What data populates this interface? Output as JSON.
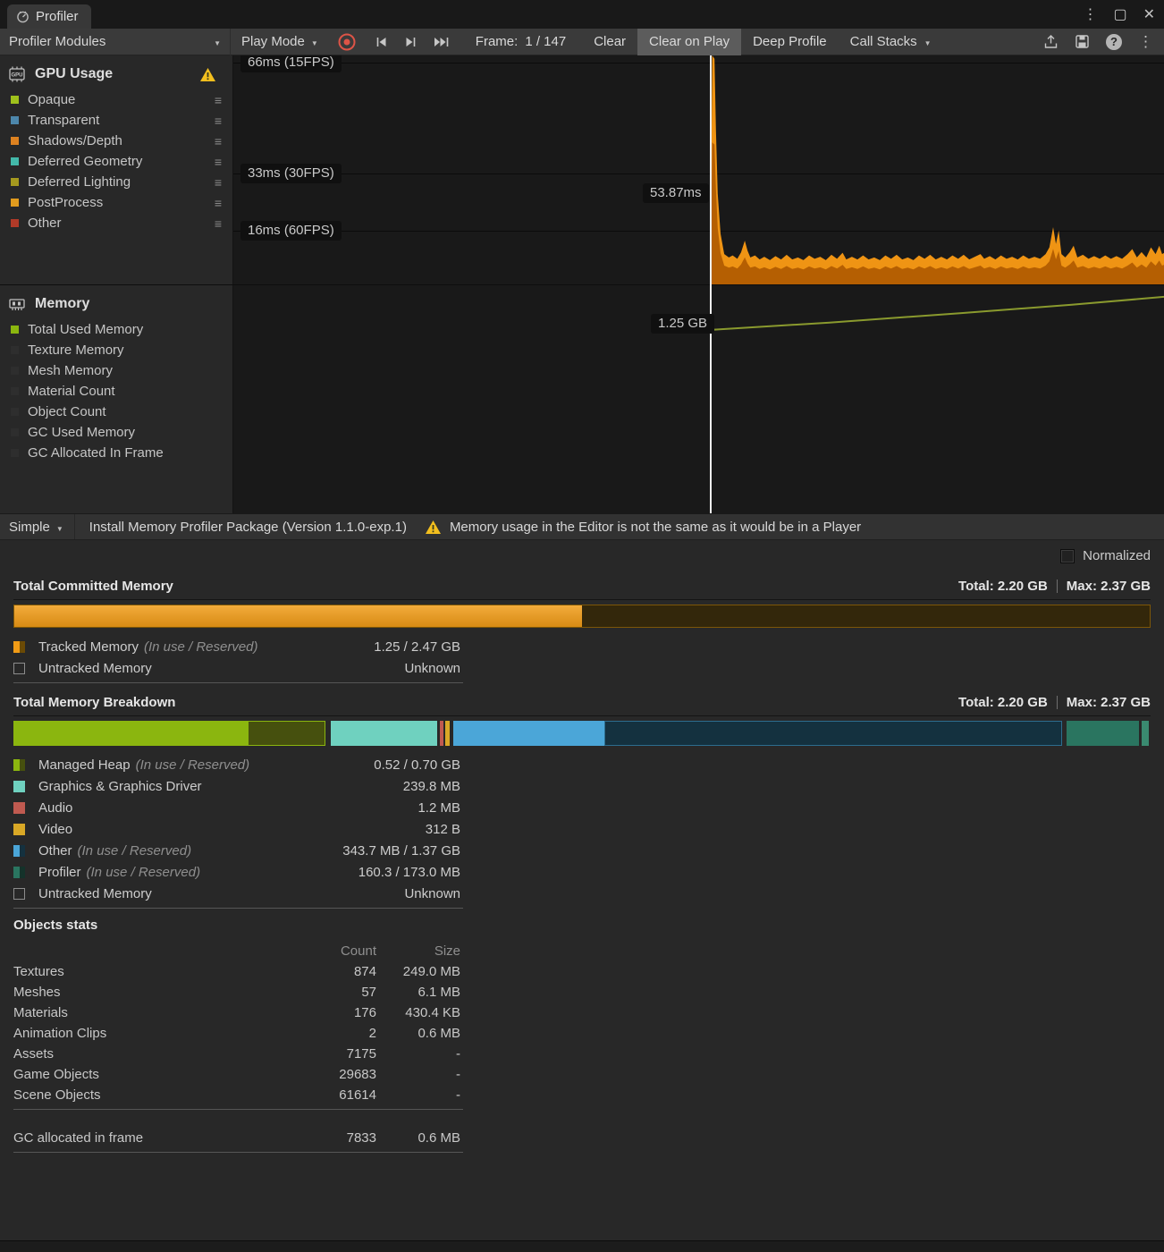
{
  "window": {
    "tab_title": "Profiler",
    "controls": {
      "menu": "⋮",
      "maximize": "▢",
      "close": "✕"
    }
  },
  "toolbar": {
    "modules_dropdown": "Profiler Modules",
    "play_mode_dropdown": "Play Mode",
    "frame_label": "Frame:",
    "frame_value": "1 / 147",
    "clear_button": "Clear",
    "clear_on_play_button": "Clear on Play",
    "deep_profile_button": "Deep Profile",
    "call_stacks_button": "Call Stacks",
    "help_glyph": "?"
  },
  "gpu_module": {
    "title": "GPU Usage",
    "icon_text": "GPU",
    "series": [
      {
        "label": "Opaque",
        "color": "#9fc11c"
      },
      {
        "label": "Transparent",
        "color": "#4d87ab"
      },
      {
        "label": "Shadows/Depth",
        "color": "#dd8220"
      },
      {
        "label": "Deferred Geometry",
        "color": "#43b8a9"
      },
      {
        "label": "Deferred Lighting",
        "color": "#a5991f"
      },
      {
        "label": "PostProcess",
        "color": "#e09b1e"
      },
      {
        "label": "Other",
        "color": "#b03a28"
      }
    ]
  },
  "memory_module": {
    "title": "Memory",
    "series": [
      {
        "label": "Total Used Memory",
        "color": "#8bb60f"
      },
      {
        "label": "Texture Memory",
        "color": "#2e2e2e"
      },
      {
        "label": "Mesh Memory",
        "color": "#2e2e2e"
      },
      {
        "label": "Material Count",
        "color": "#2e2e2e"
      },
      {
        "label": "Object Count",
        "color": "#2e2e2e"
      },
      {
        "label": "GC Used Memory",
        "color": "#2e2e2e"
      },
      {
        "label": "GC Allocated In Frame",
        "color": "#2e2e2e"
      }
    ]
  },
  "chart_data": [
    {
      "type": "area",
      "title": "GPU Usage frame time",
      "ymax_ms": 68,
      "playhead_frac": 0.5125,
      "tooltip": "53.87ms",
      "ylabels": [
        {
          "text": "66ms (15FPS)",
          "ms": 66
        },
        {
          "text": "33ms (30FPS)",
          "ms": 33
        },
        {
          "text": "16ms (60FPS)",
          "ms": 16
        }
      ],
      "colors": {
        "top": "#ef9414",
        "body": "#b55f02"
      },
      "points": [
        [
          0.5125,
          0
        ],
        [
          0.5128,
          22
        ],
        [
          0.514,
          68
        ],
        [
          0.5165,
          67
        ],
        [
          0.518,
          46
        ],
        [
          0.52,
          27
        ],
        [
          0.523,
          15
        ],
        [
          0.527,
          9
        ],
        [
          0.532,
          8
        ],
        [
          0.536,
          8.6
        ],
        [
          0.541,
          7.6
        ],
        [
          0.545,
          9.5
        ],
        [
          0.549,
          13
        ],
        [
          0.552,
          10
        ],
        [
          0.555,
          8
        ],
        [
          0.56,
          8.6
        ],
        [
          0.565,
          7.4
        ],
        [
          0.57,
          8.2
        ],
        [
          0.576,
          7.2
        ],
        [
          0.582,
          8.4
        ],
        [
          0.588,
          7.4
        ],
        [
          0.594,
          8.8
        ],
        [
          0.6,
          7.4
        ],
        [
          0.606,
          8
        ],
        [
          0.612,
          7.2
        ],
        [
          0.618,
          8.6
        ],
        [
          0.624,
          7.6
        ],
        [
          0.63,
          8.2
        ],
        [
          0.636,
          7.2
        ],
        [
          0.642,
          8.8
        ],
        [
          0.648,
          7.6
        ],
        [
          0.654,
          9.4
        ],
        [
          0.658,
          7.4
        ],
        [
          0.664,
          8.2
        ],
        [
          0.67,
          7.4
        ],
        [
          0.676,
          8.6
        ],
        [
          0.682,
          7.4
        ],
        [
          0.688,
          8
        ],
        [
          0.694,
          7.2
        ],
        [
          0.7,
          8.6
        ],
        [
          0.706,
          7.6
        ],
        [
          0.712,
          8.8
        ],
        [
          0.718,
          7.4
        ],
        [
          0.724,
          8
        ],
        [
          0.73,
          7.2
        ],
        [
          0.736,
          8.6
        ],
        [
          0.742,
          7.6
        ],
        [
          0.748,
          8.8
        ],
        [
          0.754,
          7.4
        ],
        [
          0.76,
          8.2
        ],
        [
          0.766,
          7.4
        ],
        [
          0.772,
          8.6
        ],
        [
          0.778,
          7.6
        ],
        [
          0.784,
          8.8
        ],
        [
          0.79,
          7.4
        ],
        [
          0.796,
          8.2
        ],
        [
          0.802,
          9
        ],
        [
          0.806,
          7.6
        ],
        [
          0.812,
          8.4
        ],
        [
          0.818,
          7.4
        ],
        [
          0.824,
          8.6
        ],
        [
          0.83,
          7.6
        ],
        [
          0.836,
          8.2
        ],
        [
          0.842,
          7.4
        ],
        [
          0.848,
          8.6
        ],
        [
          0.854,
          7.6
        ],
        [
          0.86,
          8.2
        ],
        [
          0.866,
          7.6
        ],
        [
          0.872,
          9
        ],
        [
          0.876,
          11
        ],
        [
          0.88,
          17
        ],
        [
          0.883,
          12
        ],
        [
          0.886,
          16
        ],
        [
          0.889,
          9
        ],
        [
          0.893,
          8
        ],
        [
          0.898,
          9.6
        ],
        [
          0.902,
          11.5
        ],
        [
          0.906,
          8
        ],
        [
          0.912,
          8.8
        ],
        [
          0.918,
          7.6
        ],
        [
          0.924,
          8.4
        ],
        [
          0.93,
          7.6
        ],
        [
          0.936,
          8.6
        ],
        [
          0.942,
          7.6
        ],
        [
          0.948,
          8.4
        ],
        [
          0.954,
          7.6
        ],
        [
          0.96,
          9
        ],
        [
          0.965,
          10.5
        ],
        [
          0.97,
          8
        ],
        [
          0.975,
          9.6
        ],
        [
          0.98,
          8
        ],
        [
          0.985,
          11
        ],
        [
          0.99,
          9
        ],
        [
          0.994,
          11.5
        ],
        [
          0.997,
          9
        ],
        [
          1.0,
          9.5
        ]
      ]
    },
    {
      "type": "line",
      "title": "Total Used Memory",
      "label": "1.25 GB",
      "color": "#8a9a2e",
      "playhead_frac": 0.5125,
      "points": [
        [
          0.5125,
          0.195
        ],
        [
          0.64,
          0.163
        ],
        [
          0.78,
          0.122
        ],
        [
          0.9,
          0.085
        ],
        [
          1.0,
          0.05
        ]
      ]
    }
  ],
  "detail_toolbar": {
    "view_dropdown": "Simple",
    "install_button": "Install Memory Profiler Package (Version 1.1.0-exp.1)",
    "editor_warning": "Memory usage in the Editor is not the same as it would be in a Player"
  },
  "normalized_label": "Normalized",
  "committed": {
    "title": "Total Committed Memory",
    "total": "Total: 2.20 GB",
    "max": "Max: 2.37 GB",
    "bar": {
      "fill_percent": 50,
      "fill_color": "#f09b16",
      "track_color": "#33270b",
      "border_color": "#7d5608"
    },
    "rows": [
      {
        "label": "Tracked Memory",
        "note": "(In use / Reserved)",
        "value": "1.25 / 2.47 GB",
        "c1": "#f09b16",
        "c2": "#6b4a05"
      },
      {
        "label": "Untracked Memory",
        "note": "",
        "value": "Unknown"
      }
    ]
  },
  "breakdown": {
    "title": "Total Memory Breakdown",
    "total": "Total: 2.20 GB",
    "max": "Max: 2.37 GB",
    "segments": [
      {
        "color": "#8bb60f",
        "width": 20.6
      },
      {
        "color": "#46500e",
        "width": 6.8,
        "border": "#8bb60f"
      },
      {
        "color": "transparent",
        "width": 0.5
      },
      {
        "color": "#6fd1bf",
        "width": 9.4
      },
      {
        "color": "transparent",
        "width": 0.2
      },
      {
        "color": "#c05a50",
        "width": 0.35
      },
      {
        "color": "transparent",
        "width": 0.1
      },
      {
        "color": "#d9a826",
        "width": 0.4
      },
      {
        "color": "transparent",
        "width": 0.3
      },
      {
        "color": "#4ba6d8",
        "width": 13.3
      },
      {
        "color": "#14313f",
        "width": 40.3,
        "border": "#2d6d8e"
      },
      {
        "color": "transparent",
        "width": 0.4
      },
      {
        "color": "#2a7560",
        "width": 6.3
      },
      {
        "color": "transparent",
        "width": 0.3
      },
      {
        "color": "#3a8a70",
        "width": 0.6
      }
    ],
    "rows": [
      {
        "label": "Managed Heap",
        "note": "(In use / Reserved)",
        "value": "0.52 / 0.70 GB",
        "c1": "#8bb60f",
        "c2": "#46500e"
      },
      {
        "label": "Graphics & Graphics Driver",
        "note": "",
        "value": "239.8 MB",
        "c1": "#6fd1bf",
        "c2": "#6fd1bf"
      },
      {
        "label": "Audio",
        "note": "",
        "value": "1.2 MB",
        "c1": "#c05a50",
        "c2": "#c05a50"
      },
      {
        "label": "Video",
        "note": "",
        "value": "312 B",
        "c1": "#d9a826",
        "c2": "#d9a826"
      },
      {
        "label": "Other",
        "note": "(In use / Reserved)",
        "value": "343.7 MB / 1.37 GB",
        "c1": "#4ba6d8",
        "c2": "#14313f"
      },
      {
        "label": "Profiler",
        "note": "(In use / Reserved)",
        "value": "160.3 / 173.0 MB",
        "c1": "#2a7560",
        "c2": "#14322a"
      },
      {
        "label": "Untracked Memory",
        "note": "",
        "value": "Unknown"
      }
    ]
  },
  "objects_stats": {
    "title": "Objects stats",
    "columns": {
      "count": "Count",
      "size": "Size"
    },
    "rows": [
      {
        "label": "Textures",
        "count": "874",
        "size": "249.0 MB"
      },
      {
        "label": "Meshes",
        "count": "57",
        "size": "6.1 MB"
      },
      {
        "label": "Materials",
        "count": "176",
        "size": "430.4 KB"
      },
      {
        "label": "Animation Clips",
        "count": "2",
        "size": "0.6 MB"
      },
      {
        "label": "Assets",
        "count": "7175",
        "size": "-"
      },
      {
        "label": "Game Objects",
        "count": "29683",
        "size": "-"
      },
      {
        "label": "Scene Objects",
        "count": "61614",
        "size": "-"
      }
    ],
    "gc_row": {
      "label": "GC allocated in frame",
      "count": "7833",
      "size": "0.6 MB"
    }
  }
}
